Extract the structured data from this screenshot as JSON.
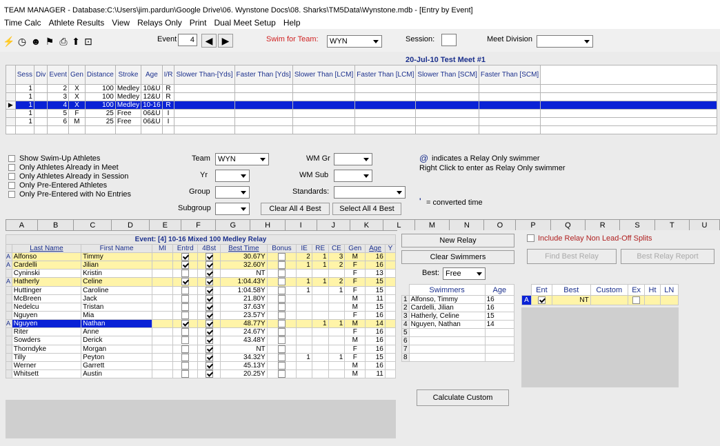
{
  "window": {
    "title": "TEAM MANAGER - Database:C:\\Users\\jim.pardun\\Google Drive\\06. Wynstone Docs\\08. Sharks\\TM5Data\\Wynstone.mdb - [Entry by Event]"
  },
  "menu": [
    "Time Calc",
    "Athlete Results",
    "View",
    "Relays Only",
    "Print",
    "Dual Meet Setup",
    "Help"
  ],
  "toolbar": {
    "event_label": "Event",
    "event_value": "4",
    "swim_for_team_label": "Swim for Team:",
    "swim_for_team_value": "WYN",
    "session_label": "Session:",
    "session_value": "",
    "meet_division_label": "Meet Division",
    "meet_division_value": ""
  },
  "meet_header": "20-Jul-10  Test Meet #1",
  "event_table": {
    "columns": [
      "Sess",
      "Div",
      "Event",
      "Gen",
      "Distance",
      "Stroke",
      "Age",
      "I/R",
      "Slower Than-[Yds]",
      "Faster Than [Yds]",
      "Slower Than [LCM]",
      "Faster Than [LCM]",
      "Slower Than [SCM]",
      "Faster Than [SCM]"
    ],
    "rows": [
      {
        "sess": "1",
        "div": "",
        "event": "2",
        "gen": "X",
        "dist": "100",
        "stroke": "Medley",
        "age": "10&U",
        "ir": "R"
      },
      {
        "sess": "1",
        "div": "",
        "event": "3",
        "gen": "X",
        "dist": "100",
        "stroke": "Medley",
        "age": "12&U",
        "ir": "R"
      },
      {
        "sess": "1",
        "div": "",
        "event": "4",
        "gen": "X",
        "dist": "100",
        "stroke": "Medley",
        "age": "10-16",
        "ir": "R"
      },
      {
        "sess": "1",
        "div": "",
        "event": "5",
        "gen": "F",
        "dist": "25",
        "stroke": "Free",
        "age": "06&U",
        "ir": "I"
      },
      {
        "sess": "1",
        "div": "",
        "event": "6",
        "gen": "M",
        "dist": "25",
        "stroke": "Free",
        "age": "06&U",
        "ir": "I"
      }
    ]
  },
  "filters": {
    "checkboxes": [
      "Show Swim-Up Athletes",
      "Only Athletes Already in Meet",
      "Only Athletes Already in Session",
      "Only Pre-Entered Athletes",
      "Only Pre-Entered with No Entries"
    ],
    "team_label": "Team",
    "team_value": "WYN",
    "yr_label": "Yr",
    "group_label": "Group",
    "subgroup_label": "Subgroup",
    "wm_gr_label": "WM Gr",
    "wm_sub_label": "WM Sub",
    "standards_label": "Standards:",
    "clear_all_label": "Clear All 4 Best",
    "select_all_label": "Select All 4 Best",
    "relay_note_symbol": "@",
    "relay_note_1": "indicates a Relay Only swimmer",
    "relay_note_2": "Right Click to enter as Relay Only swimmer",
    "converted_symbol": "'",
    "converted_note": "= converted time"
  },
  "column_letters": [
    "A",
    "B",
    "C",
    "D",
    "E",
    "F",
    "G",
    "H",
    "I",
    "J",
    "K",
    "L",
    "M",
    "N",
    "O",
    "P",
    "Q",
    "R",
    "S",
    "T",
    "U"
  ],
  "athletes": {
    "event_title": "Event: [4]  10-16  Mixed  100  Medley Relay",
    "columns": [
      "Last Name",
      "First Name",
      "MI",
      "Entrd",
      "4Bst",
      "Best Time",
      "Bonus",
      "IE",
      "RE",
      "CE",
      "Gen",
      "Age",
      "Y"
    ],
    "rows": [
      {
        "last": "Alfonso",
        "first": "Timmy",
        "entrd": true,
        "best4": true,
        "time": "30.67Y",
        "ie": "2",
        "re": "1",
        "ce": "3",
        "gen": "M",
        "age": "16",
        "hl": true
      },
      {
        "last": "Cardelli",
        "first": "Jilian",
        "entrd": true,
        "best4": true,
        "time": "32.60Y",
        "ie": "1",
        "re": "1",
        "ce": "2",
        "gen": "F",
        "age": "16",
        "hl": true
      },
      {
        "last": "Cyninski",
        "first": "Kristin",
        "entrd": false,
        "best4": true,
        "time": "NT",
        "ie": "",
        "re": "",
        "ce": "",
        "gen": "F",
        "age": "13",
        "hl": false
      },
      {
        "last": "Hatherly",
        "first": "Celine",
        "entrd": true,
        "best4": true,
        "time": "1:04.43Y",
        "ie": "1",
        "re": "1",
        "ce": "2",
        "gen": "F",
        "age": "15",
        "hl": true
      },
      {
        "last": "Huttinger",
        "first": "Caroline",
        "entrd": false,
        "best4": true,
        "time": "1:04.58Y",
        "ie": "1",
        "re": "",
        "ce": "1",
        "gen": "F",
        "age": "15",
        "hl": false
      },
      {
        "last": "McBreen",
        "first": "Jack",
        "entrd": false,
        "best4": true,
        "time": "21.80Y",
        "ie": "",
        "re": "",
        "ce": "",
        "gen": "M",
        "age": "11",
        "hl": false
      },
      {
        "last": "Nedelcu",
        "first": "Tristan",
        "entrd": false,
        "best4": true,
        "time": "37.63Y",
        "ie": "",
        "re": "",
        "ce": "",
        "gen": "M",
        "age": "15",
        "hl": false
      },
      {
        "last": "Nguyen",
        "first": "Mia",
        "entrd": false,
        "best4": true,
        "time": "23.57Y",
        "ie": "",
        "re": "",
        "ce": "",
        "gen": "F",
        "age": "16",
        "hl": false
      },
      {
        "last": "Nguyen",
        "first": "Nathan",
        "entrd": true,
        "best4": true,
        "time": "48.77Y",
        "ie": "",
        "re": "1",
        "ce": "1",
        "gen": "M",
        "age": "14",
        "hl": true,
        "sel": true
      },
      {
        "last": "Riter",
        "first": "Anne",
        "entrd": false,
        "best4": true,
        "time": "24.67Y",
        "ie": "",
        "re": "",
        "ce": "",
        "gen": "F",
        "age": "16",
        "hl": false
      },
      {
        "last": "Sowders",
        "first": "Derick",
        "entrd": false,
        "best4": true,
        "time": "43.48Y",
        "ie": "",
        "re": "",
        "ce": "",
        "gen": "M",
        "age": "16",
        "hl": false
      },
      {
        "last": "Thorndyke",
        "first": "Morgan",
        "entrd": false,
        "best4": true,
        "time": "NT",
        "ie": "",
        "re": "",
        "ce": "",
        "gen": "F",
        "age": "16",
        "hl": false
      },
      {
        "last": "Tilly",
        "first": "Peyton",
        "entrd": false,
        "best4": true,
        "time": "34.32Y",
        "ie": "1",
        "re": "",
        "ce": "1",
        "gen": "F",
        "age": "15",
        "hl": false
      },
      {
        "last": "Werner",
        "first": "Garrett",
        "entrd": false,
        "best4": true,
        "time": "45.13Y",
        "ie": "",
        "re": "",
        "ce": "",
        "gen": "M",
        "age": "16",
        "hl": false
      },
      {
        "last": "Whitsett",
        "first": "Austin",
        "entrd": false,
        "best4": true,
        "time": "20.25Y",
        "ie": "",
        "re": "",
        "ce": "",
        "gen": "M",
        "age": "11",
        "hl": false
      }
    ]
  },
  "relay": {
    "new_relay": "New Relay",
    "clear_swimmers": "Clear Swimmers",
    "best_label": "Best:",
    "best_value": "Free",
    "include_non_leadoff": "Include Relay Non Lead-Off Splits",
    "find_best": "Find Best Relay",
    "best_report": "Best Relay Report",
    "calculate_custom": "Calculate Custom",
    "swimmers_header": "Swimmers",
    "age_header": "Age",
    "swimmers": [
      {
        "n": "1",
        "name": "Alfonso, Timmy",
        "age": "16"
      },
      {
        "n": "2",
        "name": "Cardelli, Jilian",
        "age": "16"
      },
      {
        "n": "3",
        "name": "Hatherly, Celine",
        "age": "15"
      },
      {
        "n": "4",
        "name": "Nguyen, Nathan",
        "age": "14"
      },
      {
        "n": "5",
        "name": "",
        "age": ""
      },
      {
        "n": "6",
        "name": "",
        "age": ""
      },
      {
        "n": "7",
        "name": "",
        "age": ""
      },
      {
        "n": "8",
        "name": "",
        "age": ""
      }
    ],
    "best_cols": [
      "Ent",
      "Best",
      "Custom",
      "Ex",
      "Ht",
      "LN"
    ],
    "best_row": {
      "letter": "A",
      "ent": true,
      "best": "NT",
      "custom": "",
      "ex": false
    }
  }
}
